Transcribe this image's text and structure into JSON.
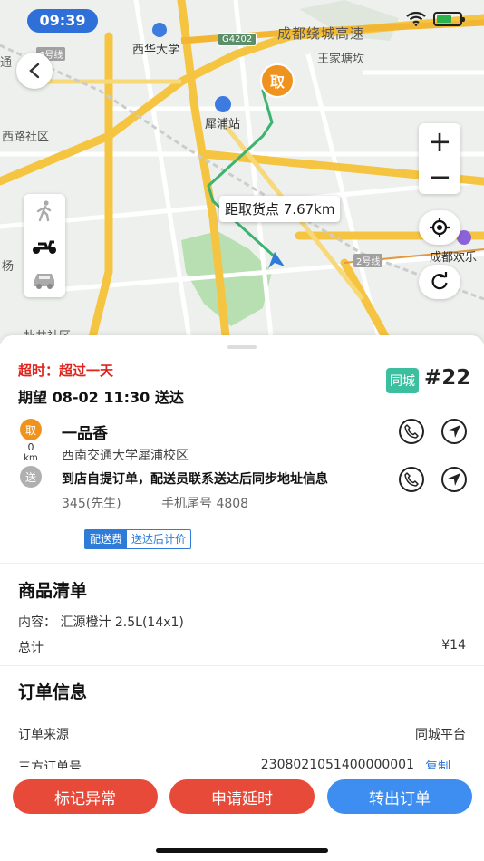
{
  "status_bar": {
    "time": "09:39"
  },
  "map": {
    "labels": {
      "xihua": "西华大学",
      "ring_road": "成都绕城高速",
      "shield_g4202": "G4202",
      "wangjiatangkan": "王家塘坎",
      "line6": "6号线",
      "xipu_station": "犀浦站",
      "xilu_community": "西路社区",
      "line2": "2号线",
      "chengdu_huanle": "成都欢乐",
      "yang": "杨",
      "cut_bottom": "扑井社区",
      "left_edge": "通"
    },
    "pickup_pin_label": "取",
    "distance_bubble": "距取货点 7.67km",
    "zoom_in": "+",
    "zoom_out": "−",
    "colors": {
      "route": "#3cb371",
      "pin": "#f0931e",
      "road_major": "#f5c542"
    }
  },
  "order": {
    "overtime": "超时：超过一天",
    "expected": "期望 08-02 11:30 送达",
    "city_tag": "同城",
    "order_number": "#22",
    "pickup_icon": "取",
    "deliver_icon": "送",
    "distance_value": "0",
    "distance_unit": "km",
    "shop_name": "一品香",
    "shop_address": "西南交通大学犀浦校区",
    "delivery_info": "到店自提订单，配送员联系送达后同步地址信息",
    "customer": "345(先生)",
    "phone_tail": "手机尾号 4808",
    "fee_label": "配送费",
    "fee_value": "送达后计价"
  },
  "goods": {
    "title": "商品清单",
    "content": "内容：  汇源橙汁 2.5L(14x1)",
    "total_label": "总计",
    "total_value": "¥14"
  },
  "order_info": {
    "title": "订单信息",
    "source_label": "订单来源",
    "source_value": "同城平台",
    "third_party_label": "三方订单号",
    "third_party_value": "2308021051400000001",
    "copy_label": "复制"
  },
  "actions": {
    "mark_abnormal": "标记异常",
    "request_delay": "申请延时",
    "transfer_order": "转出订单"
  }
}
